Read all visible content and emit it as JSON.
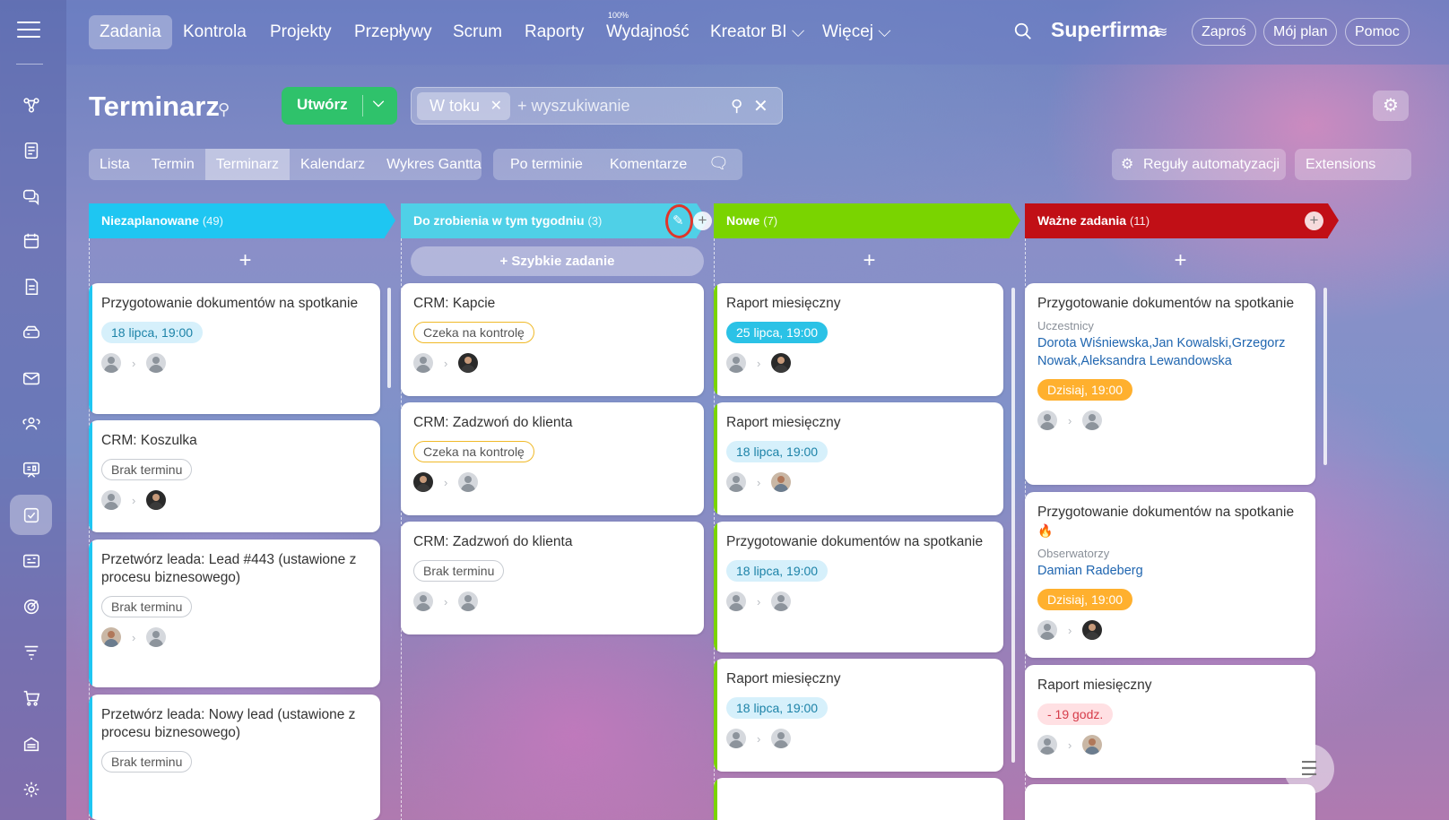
{
  "sidebar": {
    "icons": [
      "menu-icon",
      "connections-icon",
      "feed-icon",
      "chat-icon",
      "calendar-icon",
      "document-icon",
      "drive-icon",
      "mail-icon",
      "people-icon",
      "board-icon",
      "tasks-icon",
      "crm-icon",
      "goals-icon",
      "funnel-icon",
      "cart-icon",
      "store-icon",
      "settings-icon"
    ]
  },
  "topnav": {
    "items": [
      "Zadania",
      "Kontrola",
      "Projekty",
      "Przepływy",
      "Scrum",
      "Raporty",
      "Wydajność",
      "Kreator BI ⌵",
      "Więcej ⌵"
    ],
    "efficiency_badge": "100%",
    "brand": "Superfirma",
    "buttons": [
      "Zaproś",
      "Mój plan",
      "Pomoc"
    ]
  },
  "header": {
    "title": "Terminarz",
    "create_label": "Utwórz",
    "filter_chip": "W toku",
    "filter_placeholder": "+ wyszukiwanie"
  },
  "views": {
    "tabs": [
      "Lista",
      "Termin",
      "Terminarz",
      "Kalendarz",
      "Wykres Gantta"
    ],
    "active": "Terminarz",
    "sort_tabs": [
      "Po terminie",
      "Komentarze"
    ],
    "automation": "Reguły automatyzacji",
    "extensions": "Extensions"
  },
  "quick_add_label": "+ Szybkie zadanie",
  "columns": [
    {
      "title": "Niezaplanowane",
      "count": "(49)",
      "color": "#1ec6f2",
      "cards": [
        {
          "title": "Przygotowanie dokumentów na spotkanie",
          "badge": "18 lipca, 19:00"
        },
        {
          "title": "CRM: Koszulka",
          "badge": "Brak terminu"
        },
        {
          "title": "Przetwórz leada: Lead #443 (ustawione z procesu biznesowego)",
          "badge": "Brak terminu"
        },
        {
          "title": "Przetwórz leada: Nowy lead (ustawione z procesu biznesowego)",
          "badge": "Brak terminu"
        }
      ]
    },
    {
      "title": "Do zrobienia w tym tygodniu",
      "count": "(3)",
      "color": "#4fd0e7",
      "cards": [
        {
          "title": "CRM: Kapcie",
          "badge": "Czeka na kontrolę"
        },
        {
          "title": "CRM: Zadzwoń do klienta",
          "badge": "Czeka na kontrolę"
        },
        {
          "title": "CRM: Zadzwoń do klienta",
          "badge": "Brak terminu"
        }
      ]
    },
    {
      "title": "Nowe",
      "count": "(7)",
      "color": "#7ad400",
      "cards": [
        {
          "title": "Raport miesięczny",
          "badge": "25 lipca, 19:00"
        },
        {
          "title": "Raport miesięczny",
          "badge": "18 lipca, 19:00"
        },
        {
          "title": "Przygotowanie dokumentów na spotkanie",
          "badge": "18 lipca, 19:00"
        },
        {
          "title": "Raport miesięczny",
          "badge": "18 lipca, 19:00"
        }
      ]
    },
    {
      "title": "Ważne zadania",
      "count": "(11)",
      "color": "#c10f16",
      "cards": [
        {
          "title": "Przygotowanie dokumentów na spotkanie",
          "meta_label": "Uczestnicy",
          "meta_value": "Dorota Wiśniewska,Jan Kowalski,Grzegorz Nowak,Aleksandra Lewandowska",
          "badge": "Dzisiaj, 19:00"
        },
        {
          "title": "Przygotowanie dokumentów na spotkanie",
          "meta_label": "Obserwatorzy",
          "meta_value": "Damian Radeberg",
          "badge": "Dzisiaj, 19:00"
        },
        {
          "title": "Raport miesięczny",
          "badge": "- 19 godz."
        }
      ]
    }
  ]
}
